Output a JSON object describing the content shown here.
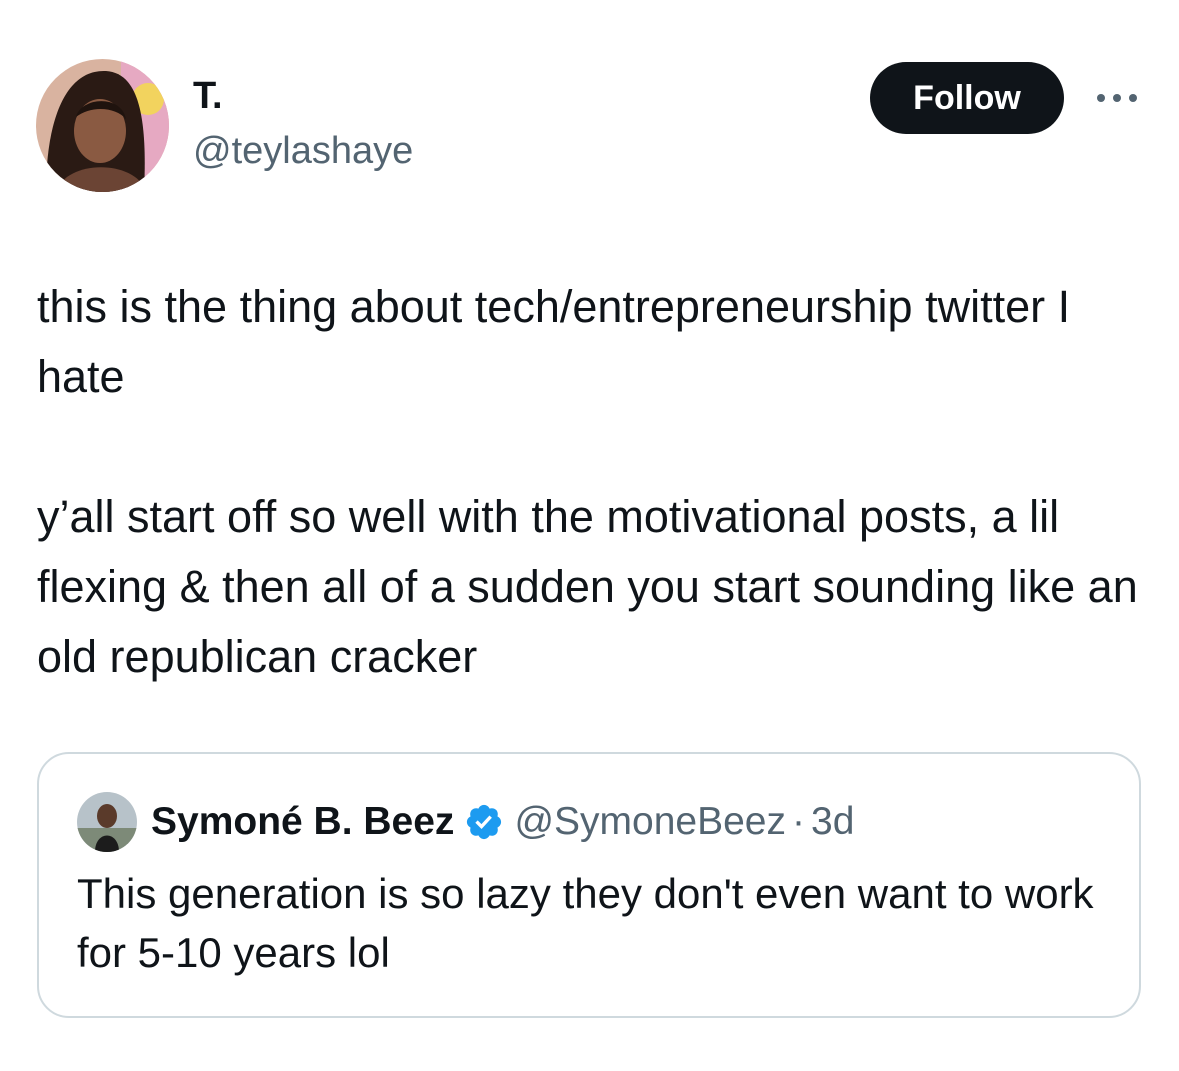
{
  "author": {
    "display_name": "T.",
    "handle": "@teylashaye",
    "avatar_icon": "profile-photo"
  },
  "actions": {
    "follow_label": "Follow",
    "more_icon": "more-horizontal-icon"
  },
  "tweet": {
    "paragraph_1": "this is the thing about tech/entrepreneurship twitter I hate",
    "paragraph_2": "y’all start off so well with the motivational posts, a lil flexing & then all of a sudden you start sounding like an old republican cracker"
  },
  "quoted_tweet": {
    "display_name": "Symoné B. Beez",
    "verified_icon": "verified-badge-icon",
    "handle": "@SymoneBeez",
    "separator": "·",
    "time": "3d",
    "text": "This generation is so lazy they don't even want to work for 5-10 years lol"
  },
  "colors": {
    "text_primary": "#0f1419",
    "text_secondary": "#536471",
    "follow_bg": "#0f1419",
    "verified_blue": "#1d9bf0",
    "card_border": "#cfd9de"
  }
}
